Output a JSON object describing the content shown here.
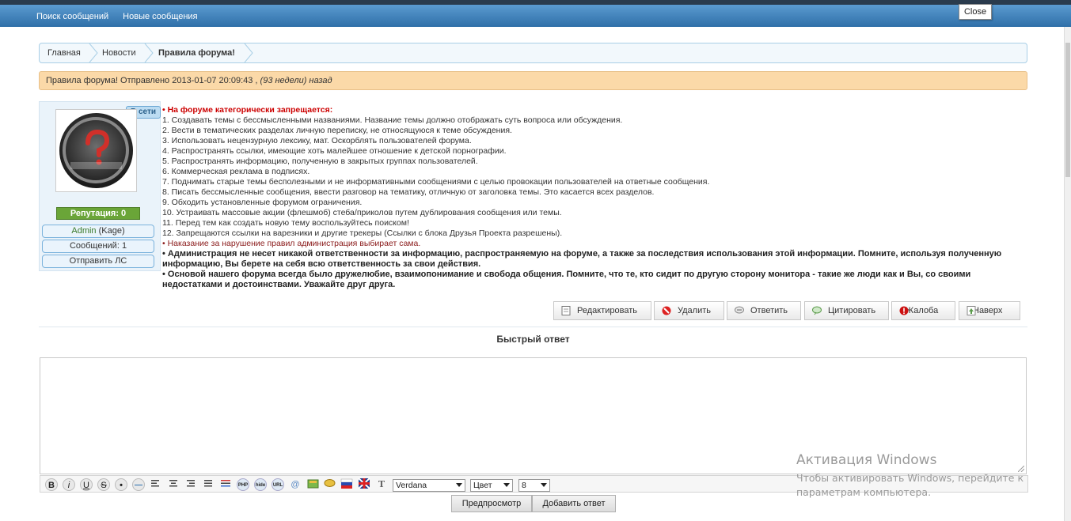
{
  "topnav": {
    "items": [
      "Поиск сообщений",
      "Новые сообщения"
    ],
    "close_tooltip": "Close"
  },
  "breadcrumb": {
    "items": [
      "Главная",
      "Новости",
      "Правила форума!"
    ]
  },
  "notice": {
    "text": "Правила форума! Отправлено 2013-01-07 20:09:43 ,",
    "relative": "(93 недели) назад"
  },
  "user": {
    "online_badge": "В сети",
    "reputation": "Репутация: 0",
    "name": "Admin",
    "name_suffix": "(Kage)",
    "posts": "Сообщений: 1",
    "pm": "Отправить ЛС"
  },
  "post": {
    "heading": "• На форуме категорически запрещается:",
    "rules": [
      "1. Создавать темы с бессмысленными названиями. Название темы должно отображать суть вопроса или обсуждения.",
      "2. Вести в тематических разделах личную переписку, не относящуюся к теме обсуждения.",
      "3. Использовать нецензурную лексику, мат. Оскорблять пользователей форума.",
      "4. Распространять ссылки, имеющие хоть малейшее отношение к детской порнографии.",
      "5. Распространять информацию, полученную в закрытых группах пользователей.",
      "6. Коммерческая реклама в подписях.",
      "7. Поднимать старые темы бесполезными и не информативными сообщениями с целью провокации пользователей на ответные сообщения.",
      "8. Писать бессмысленные сообщения, ввести разговор на тематику, отличную от заголовка темы. Это касается всех разделов.",
      "9. Обходить установленные форумом ограничения.",
      "10. Устраивать массовые акции (флешмоб) стеба/приколов путем дублирования сообщения или темы.",
      "11. Перед тем как создать новую тему воспользуйтесь поиском!",
      "12. Запрещаются ссылки на варезники и другие трекеры (Ссылки с блока Друзья Проекта разрешены)."
    ],
    "punishment": "• Наказание за нарушение правил администрация выбирает сама.",
    "disclaimer": "• Администрация не несет никакой ответственности за информацию, распространяемую на форуме, а также за последствия использования этой информации. Помните, используя полученную информацию, Вы берете на себя всю ответственность за свои действия.",
    "principle": "• Основой нашего форума всегда было дружелюбие, взаимопонимание и свобода общения. Помните, что те, кто сидит по другую сторону монитора - такие же люди как и Вы, со своими недостатками и достоинствами. Уважайте друг друга."
  },
  "actions": {
    "edit": "Редактировать",
    "delete": "Удалить",
    "reply": "Ответить",
    "quote": "Цитировать",
    "report": "Жалоба",
    "top": "Наверх"
  },
  "quick_reply": {
    "title": "Быстрый ответ",
    "font": "Verdana",
    "color": "Цвет",
    "size": "8",
    "toolbar": {
      "bold": "B",
      "italic": "i",
      "underline": "U",
      "strike": "S",
      "php": "PHP",
      "hide": "hide",
      "url": "URL",
      "text": "T"
    },
    "preview": "Предпросмотр",
    "submit": "Добавить ответ"
  },
  "watermark": {
    "title": "Активация Windows",
    "line1": "Чтобы активировать Windows, перейдите к",
    "line2": "параметрам компьютера."
  },
  "colors": {
    "header": "#3a7db8",
    "notice_bg": "#fbd9a8",
    "reputation": "#6aa538",
    "rule_heading": "#cc0000"
  }
}
